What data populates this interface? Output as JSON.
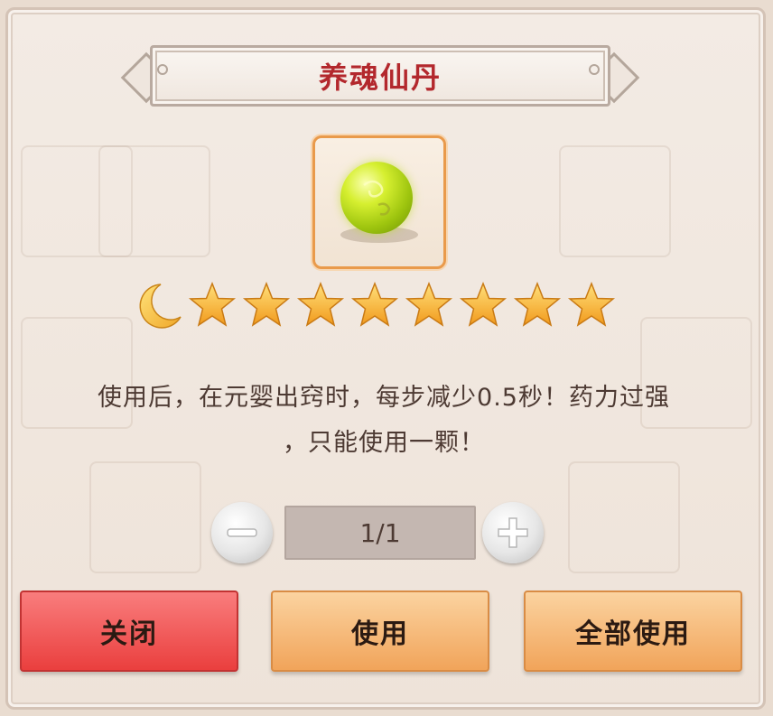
{
  "dialog": {
    "title": "养魂仙丹",
    "description_line1": "使用后，在元婴出窍时，每步减少0.5秒！药力过强",
    "description_line2": "，只能使用一颗！",
    "quantity": "1/1",
    "buttons": {
      "close": "关闭",
      "use": "使用",
      "use_all": "全部使用"
    },
    "rating": {
      "moons": 1,
      "stars": 8
    },
    "item_icon": "yellow-green-pill-orb"
  },
  "colors": {
    "title_text": "#b3282d",
    "close_button": "#ea3f3e",
    "action_button": "#f1a45a",
    "item_border": "#e99a4b"
  }
}
